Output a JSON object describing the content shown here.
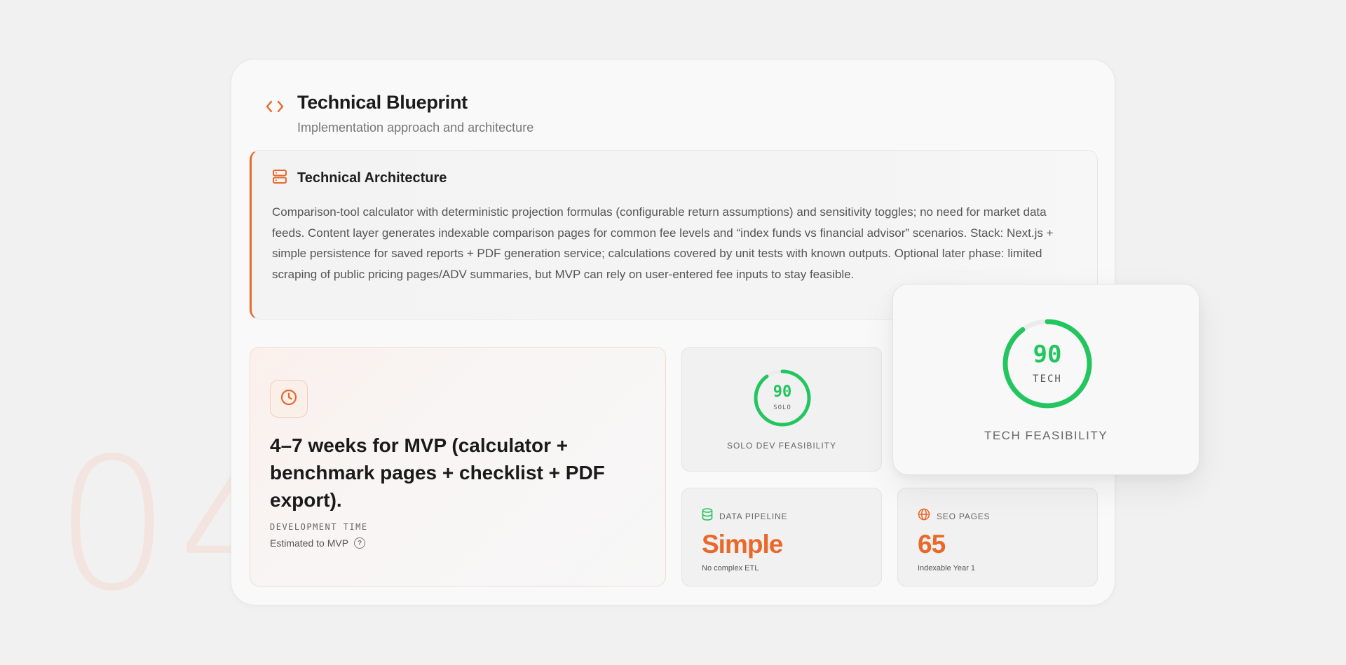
{
  "background": {
    "section_number": "04"
  },
  "header": {
    "icon": "code-icon",
    "title": "Technical Blueprint",
    "subtitle": "Implementation approach and architecture"
  },
  "architecture": {
    "icon": "server-icon",
    "title": "Technical Architecture",
    "body": "Comparison-tool calculator with deterministic projection formulas (configurable return assumptions) and sensitivity toggles; no need for market data feeds. Content layer generates indexable comparison pages for common fee levels and “index funds vs financial advisor” scenarios. Stack: Next.js + simple persistence for saved reports + PDF generation service; calculations covered by unit tests with known outputs. Optional later phase: limited scraping of public pricing pages/ADV summaries, but MVP can rely on user-entered fee inputs to stay feasible."
  },
  "development": {
    "icon": "clock-icon",
    "value": "4–7 weeks for MVP (calculator + benchmark pages + checklist + PDF export).",
    "label": "DEVELOPMENT TIME",
    "sub": "Estimated to MVP",
    "help_icon": "help-circle-icon"
  },
  "solo": {
    "score": 90,
    "score_text": "90",
    "tag": "SOLO",
    "label": "SOLO DEV FEASIBILITY"
  },
  "tech": {
    "score": 90,
    "score_text": "90",
    "tag": "TECH",
    "label": "TECH FEASIBILITY"
  },
  "data_pipeline": {
    "icon": "database-icon",
    "label": "DATA PIPELINE",
    "value": "Simple",
    "note": "No complex ETL"
  },
  "seo_pages": {
    "icon": "globe-icon",
    "label": "SEO PAGES",
    "value": "65",
    "note": "Indexable Year 1"
  },
  "colors": {
    "accent": "#e8692a",
    "success": "#22c55e",
    "ring_track": "#ececec"
  }
}
